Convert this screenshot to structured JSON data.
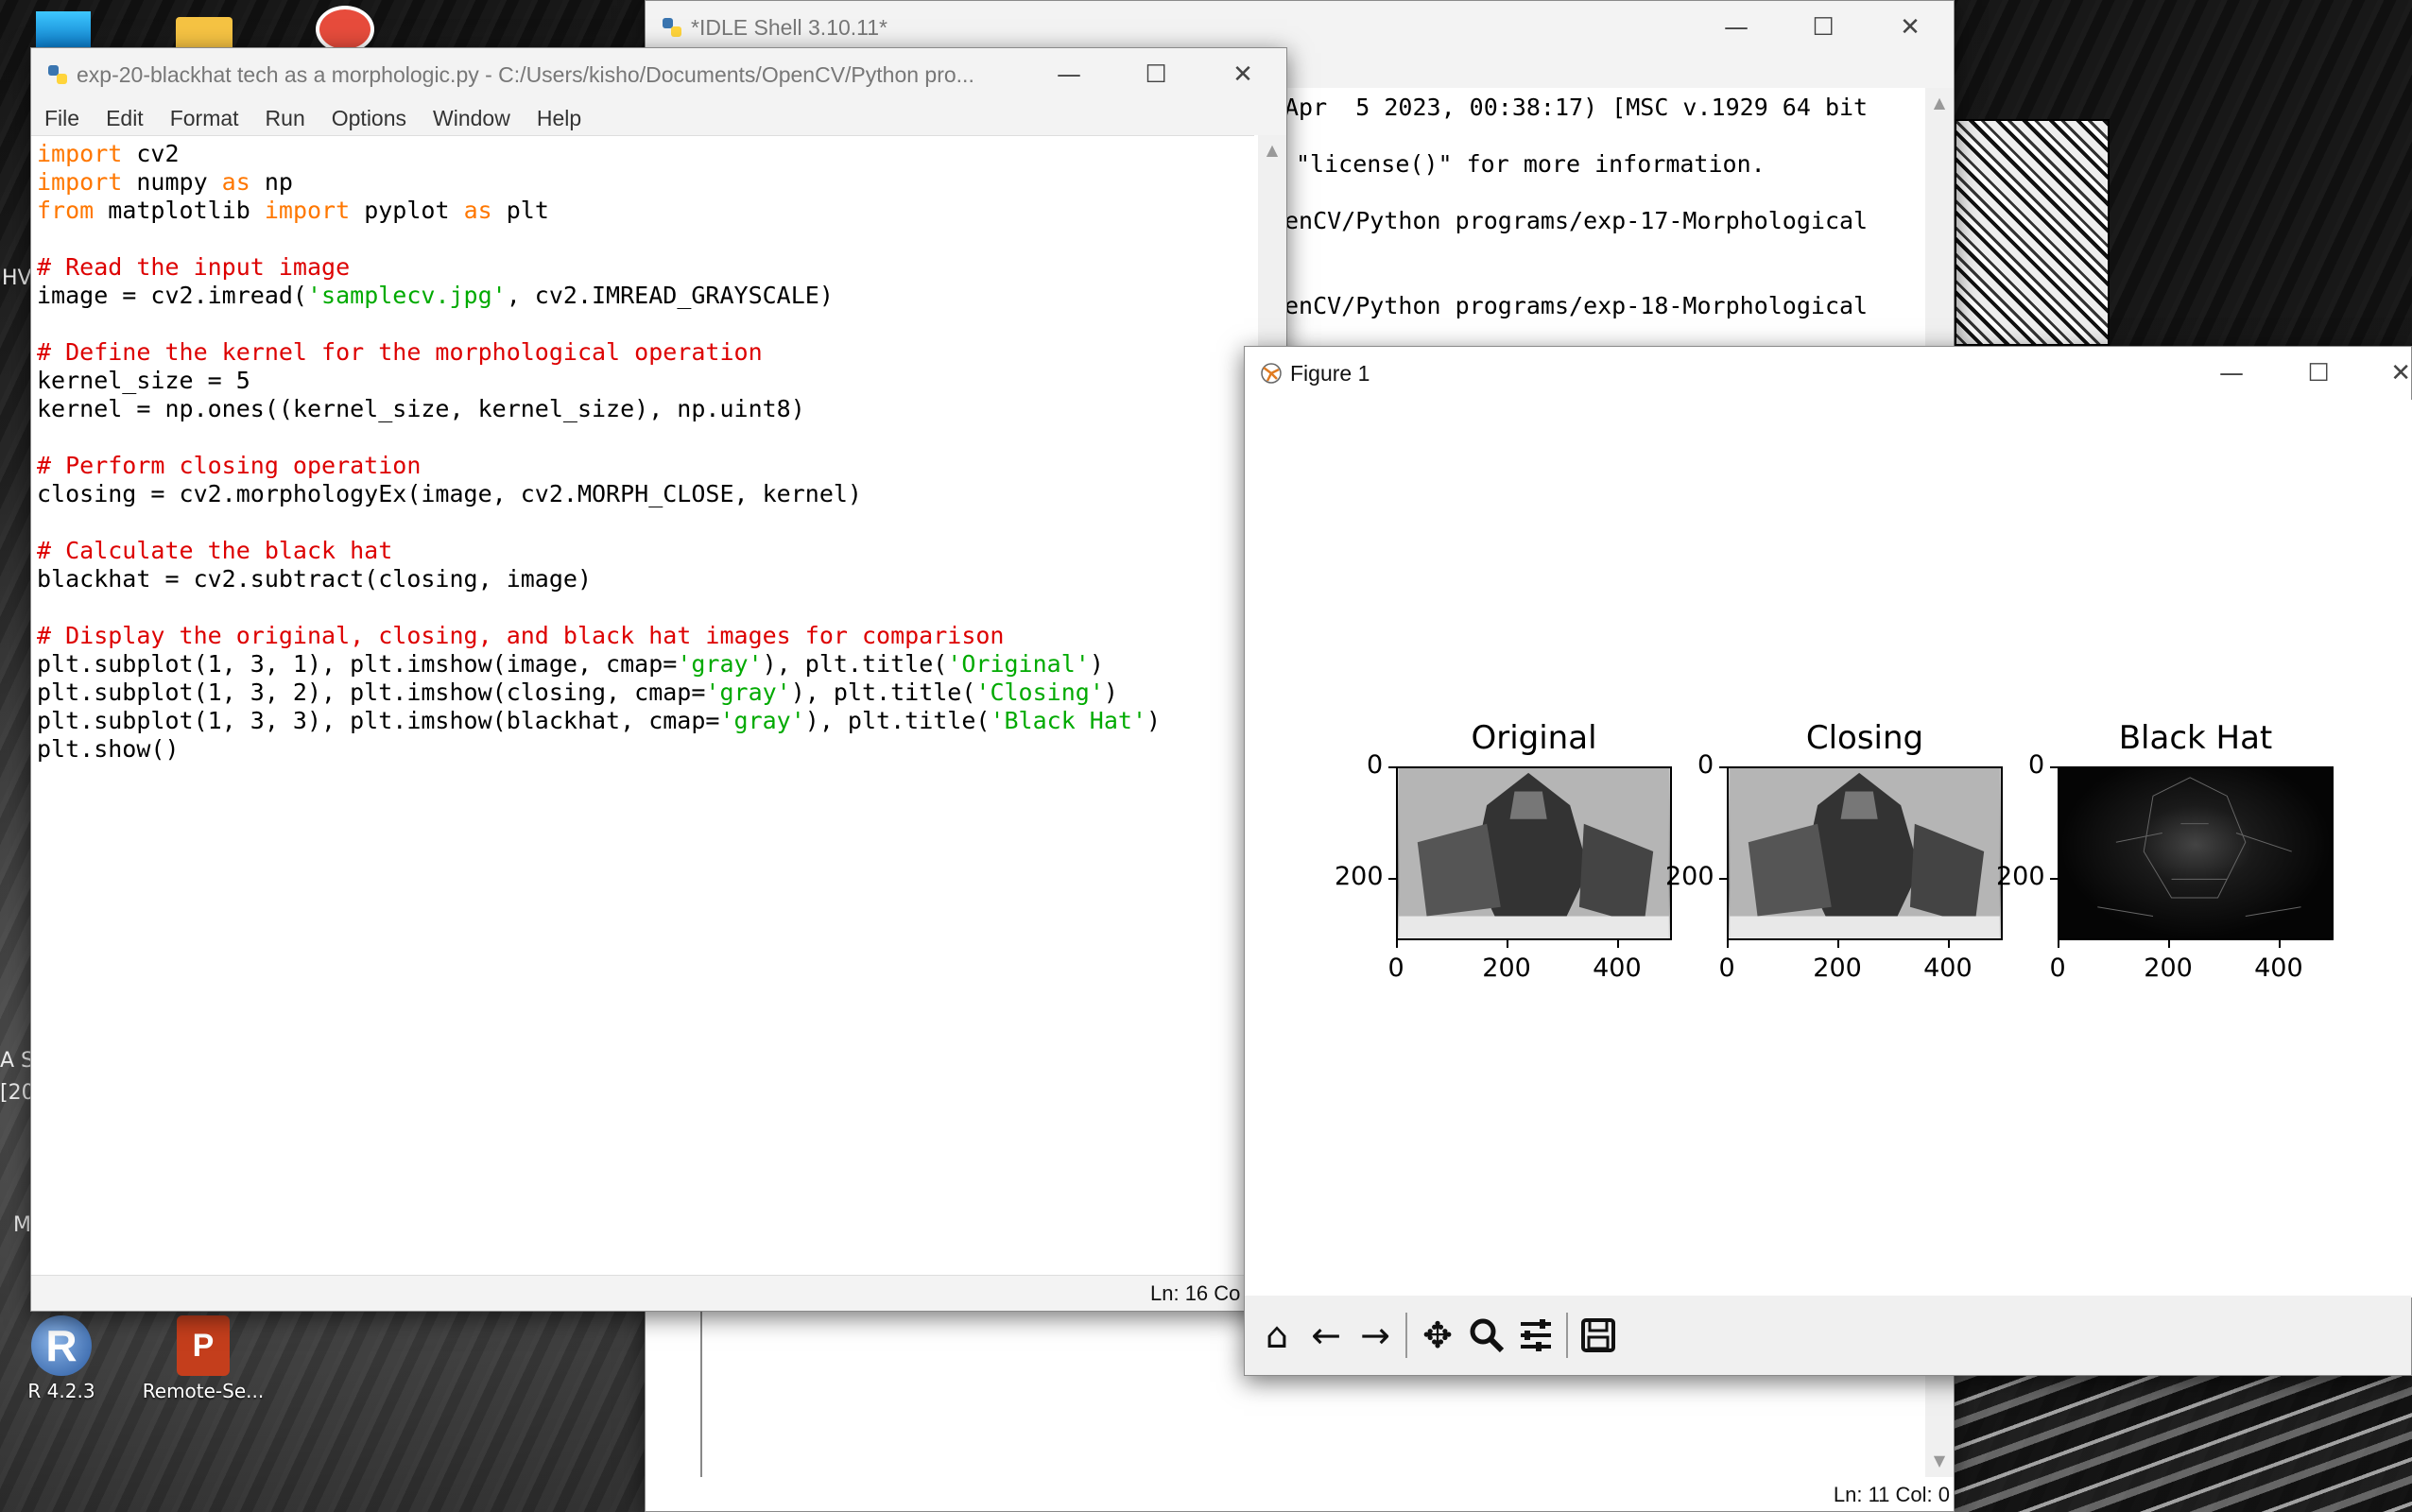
{
  "desktop": {
    "icons": [
      {
        "label": "R 4.2.3"
      },
      {
        "label": "Remote-Se..."
      }
    ],
    "edge_text": [
      "HV",
      "A Sl",
      "[20",
      "M"
    ]
  },
  "shell_window": {
    "title": "*IDLE Shell 3.10.11*",
    "lines": [
      "Apr  5 2023, 00:38:17) [MSC v.1929 64 bit",
      "\"license()\" for more information.",
      "enCV/Python programs/exp-17-Morphological",
      "",
      "enCV/Python programs/exp-18-Morphological"
    ],
    "status": "Ln: 11  Col: 0"
  },
  "editor_window": {
    "title": "exp-20-blackhat tech as a morphologic.py - C:/Users/kisho/Documents/OpenCV/Python pro...",
    "menu": [
      "File",
      "Edit",
      "Format",
      "Run",
      "Options",
      "Window",
      "Help"
    ],
    "status": "Ln: 16  Co",
    "code": [
      [
        {
          "k": "kw",
          "t": "import"
        },
        {
          "k": "",
          "t": " cv2"
        }
      ],
      [
        {
          "k": "kw",
          "t": "import"
        },
        {
          "k": "",
          "t": " numpy "
        },
        {
          "k": "kw",
          "t": "as"
        },
        {
          "k": "",
          "t": " np"
        }
      ],
      [
        {
          "k": "kw",
          "t": "from"
        },
        {
          "k": "",
          "t": " matplotlib "
        },
        {
          "k": "kw",
          "t": "import"
        },
        {
          "k": "",
          "t": " pyplot "
        },
        {
          "k": "kw",
          "t": "as"
        },
        {
          "k": "",
          "t": " plt"
        }
      ],
      [],
      [
        {
          "k": "cm",
          "t": "# Read the input image"
        }
      ],
      [
        {
          "k": "",
          "t": "image = cv2.imread("
        },
        {
          "k": "st",
          "t": "'samplecv.jpg'"
        },
        {
          "k": "",
          "t": ", cv2.IMREAD_GRAYSCALE)"
        }
      ],
      [],
      [
        {
          "k": "cm",
          "t": "# Define the kernel for the morphological operation"
        }
      ],
      [
        {
          "k": "",
          "t": "kernel_size = 5"
        }
      ],
      [
        {
          "k": "",
          "t": "kernel = np.ones((kernel_size, kernel_size), np.uint8)"
        }
      ],
      [],
      [
        {
          "k": "cm",
          "t": "# Perform closing operation"
        }
      ],
      [
        {
          "k": "",
          "t": "closing = cv2.morphologyEx(image, cv2.MORPH_CLOSE, kernel)"
        }
      ],
      [],
      [
        {
          "k": "cm",
          "t": "# Calculate the black hat"
        }
      ],
      [
        {
          "k": "",
          "t": "blackhat = cv2.subtract(closing, image)"
        }
      ],
      [],
      [
        {
          "k": "cm",
          "t": "# Display the original, closing, and black hat images for comparison"
        }
      ],
      [
        {
          "k": "",
          "t": "plt.subplot(1, 3, 1), plt.imshow(image, cmap="
        },
        {
          "k": "st",
          "t": "'gray'"
        },
        {
          "k": "",
          "t": "), plt.title("
        },
        {
          "k": "st",
          "t": "'Original'"
        },
        {
          "k": "",
          "t": ")"
        }
      ],
      [
        {
          "k": "",
          "t": "plt.subplot(1, 3, 2), plt.imshow(closing, cmap="
        },
        {
          "k": "st",
          "t": "'gray'"
        },
        {
          "k": "",
          "t": "), plt.title("
        },
        {
          "k": "st",
          "t": "'Closing'"
        },
        {
          "k": "",
          "t": ")"
        }
      ],
      [
        {
          "k": "",
          "t": "plt.subplot(1, 3, 3), plt.imshow(blackhat, cmap="
        },
        {
          "k": "st",
          "t": "'gray'"
        },
        {
          "k": "",
          "t": "), plt.title("
        },
        {
          "k": "st",
          "t": "'Black Hat'"
        },
        {
          "k": "",
          "t": ")"
        }
      ],
      [
        {
          "k": "",
          "t": "plt.show()"
        }
      ]
    ]
  },
  "figure_window": {
    "title": "Figure 1",
    "panels": [
      {
        "title": "Original",
        "variant": "light"
      },
      {
        "title": "Closing",
        "variant": "light"
      },
      {
        "title": "Black Hat",
        "variant": "dark"
      }
    ],
    "yticks": [
      "0",
      "200"
    ],
    "xticks": [
      "0",
      "200",
      "400"
    ],
    "toolbar": [
      "home-icon",
      "back-icon",
      "forward-icon",
      "pan-icon",
      "zoom-icon",
      "configure-icon",
      "save-icon"
    ]
  },
  "colors": {
    "keyword": "#ff7700",
    "comment": "#dd0000",
    "string": "#00aa00"
  }
}
